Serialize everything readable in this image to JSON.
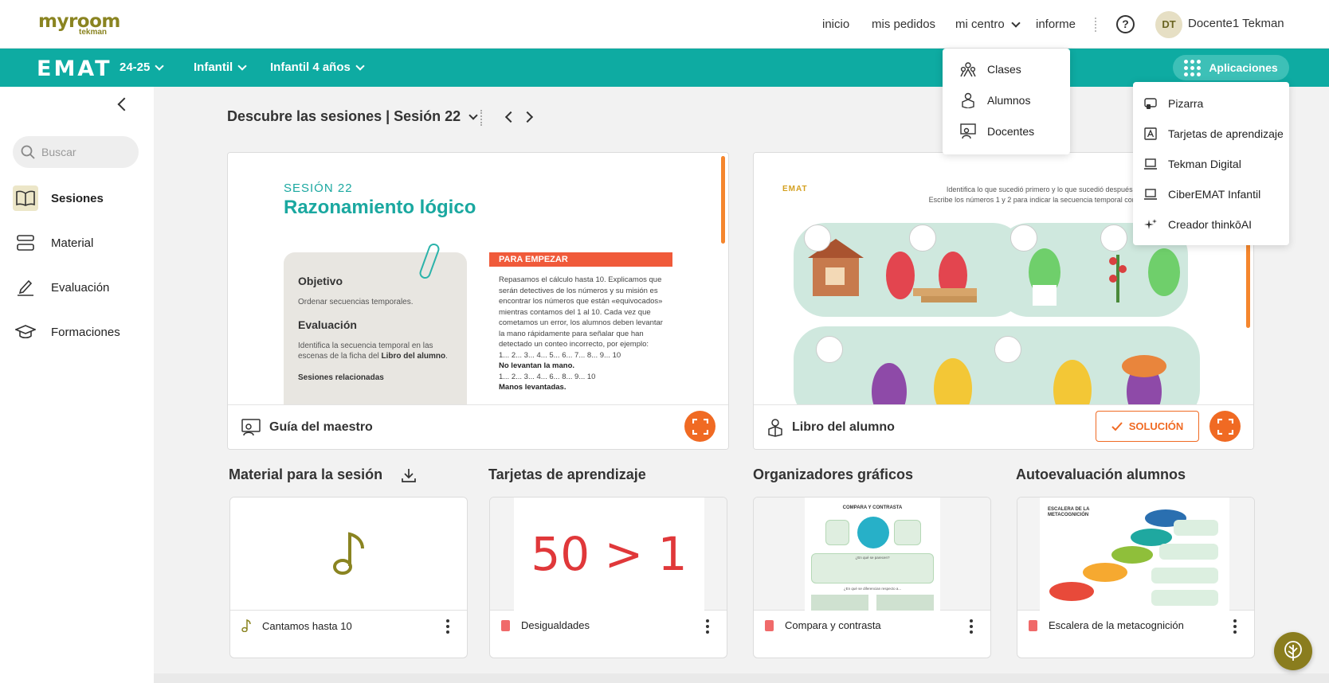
{
  "brand": {
    "logo_main": "myroom",
    "logo_sub": "tekman"
  },
  "topnav": {
    "inicio": "inicio",
    "pedidos": "mis pedidos",
    "centro": "mi centro",
    "informe": "informe",
    "help": "?",
    "avatar": "DT",
    "user": "Docente1 Tekman"
  },
  "greenbar": {
    "brand": "EMAT",
    "year": "24-25",
    "stage": "Infantil",
    "level": "Infantil 4 años",
    "apps": "Aplicaciones"
  },
  "centro_menu": [
    "Clases",
    "Alumnos",
    "Docentes"
  ],
  "apps_menu": [
    "Pizarra",
    "Tarjetas de aprendizaje",
    "Tekman Digital",
    "CiberEMAT Infantil",
    "Creador thinkōAI"
  ],
  "sidebar": {
    "search_placeholder": "Buscar",
    "items": [
      "Sesiones",
      "Material",
      "Evaluación",
      "Formaciones"
    ]
  },
  "session": {
    "title": "Descubre las sesiones | Sesión 22"
  },
  "guide": {
    "label": "Guía del maestro",
    "session": "SESIÓN 22",
    "title": "Razonamiento lógico",
    "objetivo_h": "Objetivo",
    "objetivo": "Ordenar secuencias temporales.",
    "evaluacion_h": "Evaluación",
    "evaluacion_a": "Identifica la secuencia temporal en las escenas de la ficha del ",
    "evaluacion_b": "Libro del alumno",
    "relacionadas": "Sesiones relacionadas",
    "empezar": "PARA EMPEZAR",
    "text1": "Repasamos el cálculo hasta 10. Explicamos que serán detectives de los números y su misión es encontrar los números que están «equivocados» mientras contamos del 1 al 10. Cada vez que cometamos un error, los alumnos deben levantar la mano rápidamente para señalar que han detectado un conteo incorrecto, por ejemplo:",
    "seq1": "1... 2... 3... 4... 5... 6... 7... 8... 9... 10",
    "no_levantan": "No levantan la mano.",
    "seq2": "1... 2... 3... 4... 6... 8... 9... 10",
    "levantadas": "Manos levantadas."
  },
  "book": {
    "label": "Libro del alumno",
    "solution": "SOLUCIÓN",
    "logo": "EMAT",
    "instr1": "Identifica lo que sucedió primero y lo que sucedió después.",
    "instr2": "Escribe los números 1 y 2 para indicar la secuencia temporal correcta."
  },
  "sections": {
    "material": "Material para la sesión",
    "tarjetas": "Tarjetas de aprendizaje",
    "organizadores": "Organizadores gráficos",
    "autoeval": "Autoevaluación alumnos"
  },
  "tiles": {
    "material": "Cantamos hasta 10",
    "tarjetas": "Desigualdades",
    "tarjetas_thumb": "50 > 1",
    "organizadores": "Compara y contrasta",
    "organizadores_thumb": "COMPARA Y CONTRASTA",
    "org_q1": "¿En qué se parecen?",
    "org_q2": "¿En qué se diferencian respecto a...",
    "autoeval": "Escalera de la metacognición",
    "autoeval_thumb": "ESCALERA DE LA METACOGNICIÓN"
  },
  "colors": {
    "teal": "#0eaba2",
    "orange": "#f06a23",
    "olive": "#8a8421"
  }
}
